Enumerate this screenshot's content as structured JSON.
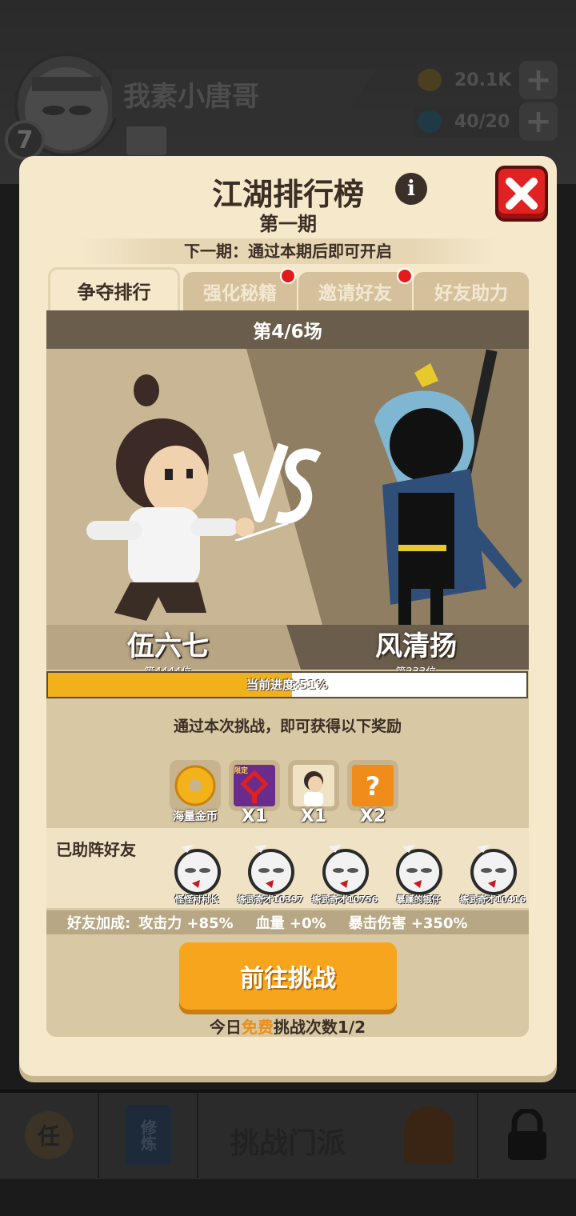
{
  "background": {
    "player_name": "我素小唐哥",
    "player_level": "7",
    "gold": "20.1K",
    "stamina": "40/20",
    "bottom_main_label": "挑战门派",
    "bottom_items": [
      "任",
      "修炼",
      "",
      "",
      ""
    ]
  },
  "modal": {
    "title": "江湖排行榜",
    "subtitle": "第一期",
    "next_period": "下一期：通过本期后即可开启",
    "tabs": [
      {
        "label": "争夺排行",
        "active": true,
        "dot": false
      },
      {
        "label": "强化秘籍",
        "active": false,
        "dot": true
      },
      {
        "label": "邀请好友",
        "active": false,
        "dot": true
      },
      {
        "label": "好友助力",
        "active": false,
        "dot": false
      }
    ],
    "round": "第4/6场",
    "vs_label": "VS",
    "player": {
      "name": "伍六七",
      "rank": "第4444位"
    },
    "opponent": {
      "name": "风清扬",
      "rank": "第233位"
    },
    "progress": {
      "label": "当前进度:51%",
      "value": 0.51
    },
    "reward_text": "通过本次挑战，即可获得以下奖励",
    "rewards": [
      {
        "icon": "gold-coin-icon",
        "label": "海量金币"
      },
      {
        "icon": "limited-knot-icon",
        "label": "X1",
        "tag": "限定"
      },
      {
        "icon": "character-portrait-icon",
        "label": "X1"
      },
      {
        "icon": "mystery-box-icon",
        "label": "X2"
      }
    ],
    "friends_title": "已助阵好友",
    "friends": [
      "怪怪村村长",
      "练武奇才10397",
      "练武奇才10756",
      "暴躁的银仔",
      "练武奇才10416"
    ],
    "bonus_prefix": "好友加成:",
    "bonuses": [
      "攻击力 +85%",
      "血量 +0%",
      "暴击伤害 +350%"
    ],
    "go_button": "前往挑战",
    "daily_prefix": "今日",
    "daily_free": "免费",
    "daily_suffix": "挑战次数1/2"
  },
  "colors": {
    "modal_bg": "#f5e8cb",
    "accent_orange": "#f6a51c",
    "progress_fill": "#f0b11b",
    "close_red": "#e02222"
  }
}
